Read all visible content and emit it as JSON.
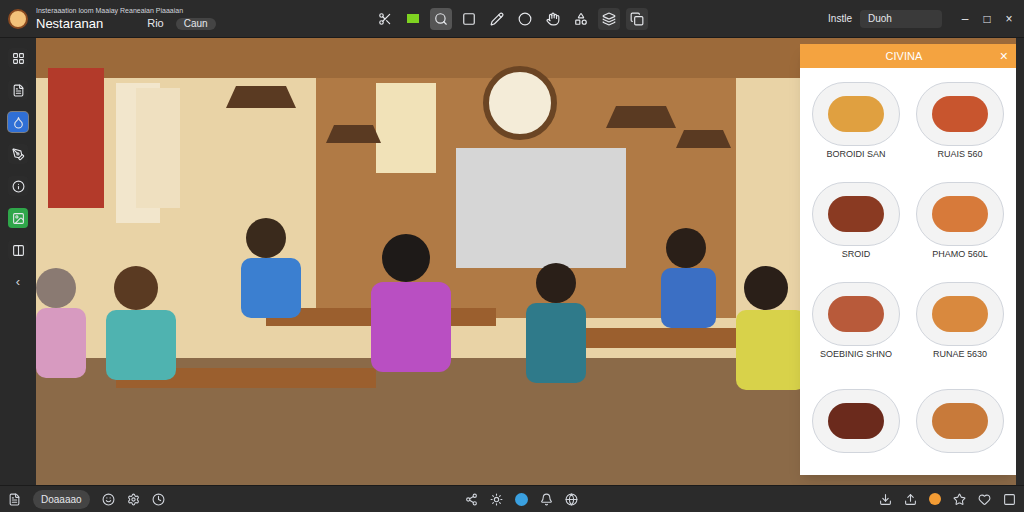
{
  "window": {
    "title": "Nestaranan",
    "menu_line": "Insteraaation loom Maaiay Reaneaian Piaaaian",
    "controls": [
      "–",
      "□",
      "×"
    ]
  },
  "header": {
    "tab": "Rio",
    "pill": "Caun",
    "right_label": "Instle",
    "search_value": "Duoh"
  },
  "toolbar": [
    {
      "selected": false
    },
    {
      "selected": false
    },
    {
      "selected": true
    },
    {
      "selected": false
    },
    {
      "selected": false
    },
    {
      "selected": false
    },
    {
      "selected": false
    },
    {
      "selected": false
    },
    {
      "selected": false
    },
    {
      "selected": false
    }
  ],
  "sidebar": {
    "items": [
      {
        "selected": false,
        "color": "#2c2c2c"
      },
      {
        "selected": false,
        "color": "#2c2c2c"
      },
      {
        "selected": true,
        "color": "#2f6fd6"
      },
      {
        "selected": false,
        "color": "#2c2c2c"
      },
      {
        "selected": false,
        "color": "#2c2c2c"
      },
      {
        "selected": false,
        "color": "#2fa64a"
      },
      {
        "selected": false,
        "color": "#2c2c2c"
      }
    ],
    "collapse": "‹"
  },
  "panel": {
    "title": "CIVINA",
    "close": "×",
    "items": [
      {
        "label": "BOROIDI SAN",
        "color": "#e0a040"
      },
      {
        "label": "RUAIS 560",
        "color": "#c8552e"
      },
      {
        "label": "SROID",
        "color": "#8a3a22"
      },
      {
        "label": "PHAMO 560L",
        "color": "#d77a3a"
      },
      {
        "label": "SOEBINIG SHNO",
        "color": "#b85a3a"
      },
      {
        "label": "RUNAE 5630",
        "color": "#d9893e"
      },
      {
        "color": "#6b2a1c"
      },
      {
        "color": "#c87a3a"
      }
    ]
  },
  "bottom_bar": {
    "button": "Doaaaao"
  }
}
